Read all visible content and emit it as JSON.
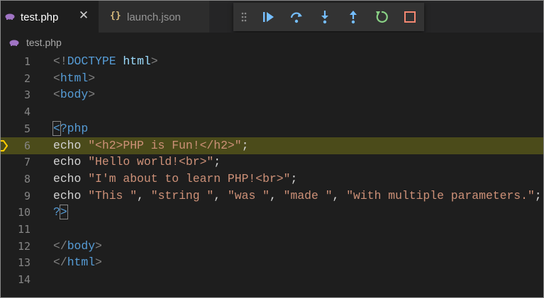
{
  "tabs": {
    "active": {
      "label": "test.php",
      "close": "✕"
    },
    "inactive": {
      "label": "launch.json",
      "icon_glyph": "{}"
    }
  },
  "breadcrumb": {
    "label": "test.php"
  },
  "debug_toolbar": {
    "buttons": [
      "continue-icon",
      "step-over-icon",
      "step-into-icon",
      "step-out-icon",
      "restart-icon",
      "stop-icon"
    ],
    "colors": {
      "blue": "#75beff",
      "green": "#89d185",
      "red": "#f48771"
    }
  },
  "editor": {
    "current_line": 6,
    "highlight_color": "#4b4b1a",
    "lines": [
      {
        "n": "1",
        "parts": [
          [
            "t-punc",
            "<!"
          ],
          [
            "t-tag",
            "DOCTYPE"
          ],
          [
            "t-kw",
            " "
          ],
          [
            "t-attr",
            "html"
          ],
          [
            "t-punc",
            ">"
          ]
        ]
      },
      {
        "n": "2",
        "parts": [
          [
            "t-punc",
            "<"
          ],
          [
            "t-tag",
            "html"
          ],
          [
            "t-punc",
            ">"
          ]
        ]
      },
      {
        "n": "3",
        "parts": [
          [
            "t-punc",
            "<"
          ],
          [
            "t-tag",
            "body"
          ],
          [
            "t-punc",
            ">"
          ]
        ]
      },
      {
        "n": "4",
        "parts": []
      },
      {
        "n": "5",
        "parts": [
          [
            "t-tag bracket-box",
            "<"
          ],
          [
            "t-tag",
            "?php"
          ]
        ]
      },
      {
        "n": "6",
        "parts": [
          [
            "t-kw",
            "echo "
          ],
          [
            "t-str",
            "\"<h2>PHP is Fun!</h2>\""
          ],
          [
            "t-kw",
            ";"
          ]
        ]
      },
      {
        "n": "7",
        "parts": [
          [
            "t-kw",
            "echo "
          ],
          [
            "t-str",
            "\"Hello world!<br>\""
          ],
          [
            "t-kw",
            ";"
          ]
        ]
      },
      {
        "n": "8",
        "parts": [
          [
            "t-kw",
            "echo "
          ],
          [
            "t-str",
            "\"I'm about to learn PHP!<br>\""
          ],
          [
            "t-kw",
            ";"
          ]
        ]
      },
      {
        "n": "9",
        "parts": [
          [
            "t-kw",
            "echo "
          ],
          [
            "t-str",
            "\"This \""
          ],
          [
            "t-kw",
            ", "
          ],
          [
            "t-str",
            "\"string \""
          ],
          [
            "t-kw",
            ", "
          ],
          [
            "t-str",
            "\"was \""
          ],
          [
            "t-kw",
            ", "
          ],
          [
            "t-str",
            "\"made \""
          ],
          [
            "t-kw",
            ", "
          ],
          [
            "t-str",
            "\"with multiple parameters.\""
          ],
          [
            "t-kw",
            ";"
          ]
        ]
      },
      {
        "n": "10",
        "parts": [
          [
            "t-tag",
            "?"
          ],
          [
            "t-tag bracket-box",
            ">"
          ]
        ]
      },
      {
        "n": "11",
        "parts": []
      },
      {
        "n": "12",
        "parts": [
          [
            "t-punc",
            "</"
          ],
          [
            "t-tag",
            "body"
          ],
          [
            "t-punc",
            ">"
          ]
        ]
      },
      {
        "n": "13",
        "parts": [
          [
            "t-punc",
            "</"
          ],
          [
            "t-tag",
            "html"
          ],
          [
            "t-punc",
            ">"
          ]
        ]
      },
      {
        "n": "14",
        "parts": []
      }
    ]
  }
}
